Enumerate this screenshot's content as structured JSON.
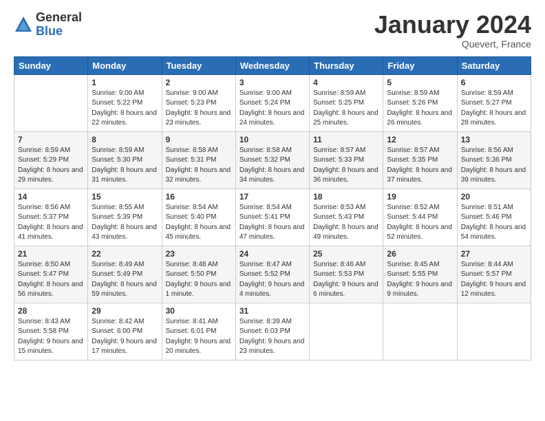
{
  "logo": {
    "general": "General",
    "blue": "Blue"
  },
  "header": {
    "month": "January 2024",
    "location": "Quevert, France"
  },
  "weekdays": [
    "Sunday",
    "Monday",
    "Tuesday",
    "Wednesday",
    "Thursday",
    "Friday",
    "Saturday"
  ],
  "weeks": [
    [
      {
        "day": "",
        "sunrise": "",
        "sunset": "",
        "daylight": ""
      },
      {
        "day": "1",
        "sunrise": "Sunrise: 9:00 AM",
        "sunset": "Sunset: 5:22 PM",
        "daylight": "Daylight: 8 hours and 22 minutes."
      },
      {
        "day": "2",
        "sunrise": "Sunrise: 9:00 AM",
        "sunset": "Sunset: 5:23 PM",
        "daylight": "Daylight: 8 hours and 23 minutes."
      },
      {
        "day": "3",
        "sunrise": "Sunrise: 9:00 AM",
        "sunset": "Sunset: 5:24 PM",
        "daylight": "Daylight: 8 hours and 24 minutes."
      },
      {
        "day": "4",
        "sunrise": "Sunrise: 8:59 AM",
        "sunset": "Sunset: 5:25 PM",
        "daylight": "Daylight: 8 hours and 25 minutes."
      },
      {
        "day": "5",
        "sunrise": "Sunrise: 8:59 AM",
        "sunset": "Sunset: 5:26 PM",
        "daylight": "Daylight: 8 hours and 26 minutes."
      },
      {
        "day": "6",
        "sunrise": "Sunrise: 8:59 AM",
        "sunset": "Sunset: 5:27 PM",
        "daylight": "Daylight: 8 hours and 28 minutes."
      }
    ],
    [
      {
        "day": "7",
        "sunrise": "Sunrise: 8:59 AM",
        "sunset": "Sunset: 5:29 PM",
        "daylight": "Daylight: 8 hours and 29 minutes."
      },
      {
        "day": "8",
        "sunrise": "Sunrise: 8:59 AM",
        "sunset": "Sunset: 5:30 PM",
        "daylight": "Daylight: 8 hours and 31 minutes."
      },
      {
        "day": "9",
        "sunrise": "Sunrise: 8:58 AM",
        "sunset": "Sunset: 5:31 PM",
        "daylight": "Daylight: 8 hours and 32 minutes."
      },
      {
        "day": "10",
        "sunrise": "Sunrise: 8:58 AM",
        "sunset": "Sunset: 5:32 PM",
        "daylight": "Daylight: 8 hours and 34 minutes."
      },
      {
        "day": "11",
        "sunrise": "Sunrise: 8:57 AM",
        "sunset": "Sunset: 5:33 PM",
        "daylight": "Daylight: 8 hours and 36 minutes."
      },
      {
        "day": "12",
        "sunrise": "Sunrise: 8:57 AM",
        "sunset": "Sunset: 5:35 PM",
        "daylight": "Daylight: 8 hours and 37 minutes."
      },
      {
        "day": "13",
        "sunrise": "Sunrise: 8:56 AM",
        "sunset": "Sunset: 5:36 PM",
        "daylight": "Daylight: 8 hours and 39 minutes."
      }
    ],
    [
      {
        "day": "14",
        "sunrise": "Sunrise: 8:56 AM",
        "sunset": "Sunset: 5:37 PM",
        "daylight": "Daylight: 8 hours and 41 minutes."
      },
      {
        "day": "15",
        "sunrise": "Sunrise: 8:55 AM",
        "sunset": "Sunset: 5:39 PM",
        "daylight": "Daylight: 8 hours and 43 minutes."
      },
      {
        "day": "16",
        "sunrise": "Sunrise: 8:54 AM",
        "sunset": "Sunset: 5:40 PM",
        "daylight": "Daylight: 8 hours and 45 minutes."
      },
      {
        "day": "17",
        "sunrise": "Sunrise: 8:54 AM",
        "sunset": "Sunset: 5:41 PM",
        "daylight": "Daylight: 8 hours and 47 minutes."
      },
      {
        "day": "18",
        "sunrise": "Sunrise: 8:53 AM",
        "sunset": "Sunset: 5:43 PM",
        "daylight": "Daylight: 8 hours and 49 minutes."
      },
      {
        "day": "19",
        "sunrise": "Sunrise: 8:52 AM",
        "sunset": "Sunset: 5:44 PM",
        "daylight": "Daylight: 8 hours and 52 minutes."
      },
      {
        "day": "20",
        "sunrise": "Sunrise: 8:51 AM",
        "sunset": "Sunset: 5:46 PM",
        "daylight": "Daylight: 8 hours and 54 minutes."
      }
    ],
    [
      {
        "day": "21",
        "sunrise": "Sunrise: 8:50 AM",
        "sunset": "Sunset: 5:47 PM",
        "daylight": "Daylight: 8 hours and 56 minutes."
      },
      {
        "day": "22",
        "sunrise": "Sunrise: 8:49 AM",
        "sunset": "Sunset: 5:49 PM",
        "daylight": "Daylight: 8 hours and 59 minutes."
      },
      {
        "day": "23",
        "sunrise": "Sunrise: 8:48 AM",
        "sunset": "Sunset: 5:50 PM",
        "daylight": "Daylight: 9 hours and 1 minute."
      },
      {
        "day": "24",
        "sunrise": "Sunrise: 8:47 AM",
        "sunset": "Sunset: 5:52 PM",
        "daylight": "Daylight: 9 hours and 4 minutes."
      },
      {
        "day": "25",
        "sunrise": "Sunrise: 8:46 AM",
        "sunset": "Sunset: 5:53 PM",
        "daylight": "Daylight: 9 hours and 6 minutes."
      },
      {
        "day": "26",
        "sunrise": "Sunrise: 8:45 AM",
        "sunset": "Sunset: 5:55 PM",
        "daylight": "Daylight: 9 hours and 9 minutes."
      },
      {
        "day": "27",
        "sunrise": "Sunrise: 8:44 AM",
        "sunset": "Sunset: 5:57 PM",
        "daylight": "Daylight: 9 hours and 12 minutes."
      }
    ],
    [
      {
        "day": "28",
        "sunrise": "Sunrise: 8:43 AM",
        "sunset": "Sunset: 5:58 PM",
        "daylight": "Daylight: 9 hours and 15 minutes."
      },
      {
        "day": "29",
        "sunrise": "Sunrise: 8:42 AM",
        "sunset": "Sunset: 6:00 PM",
        "daylight": "Daylight: 9 hours and 17 minutes."
      },
      {
        "day": "30",
        "sunrise": "Sunrise: 8:41 AM",
        "sunset": "Sunset: 6:01 PM",
        "daylight": "Daylight: 9 hours and 20 minutes."
      },
      {
        "day": "31",
        "sunrise": "Sunrise: 8:39 AM",
        "sunset": "Sunset: 6:03 PM",
        "daylight": "Daylight: 9 hours and 23 minutes."
      },
      {
        "day": "",
        "sunrise": "",
        "sunset": "",
        "daylight": ""
      },
      {
        "day": "",
        "sunrise": "",
        "sunset": "",
        "daylight": ""
      },
      {
        "day": "",
        "sunrise": "",
        "sunset": "",
        "daylight": ""
      }
    ]
  ]
}
